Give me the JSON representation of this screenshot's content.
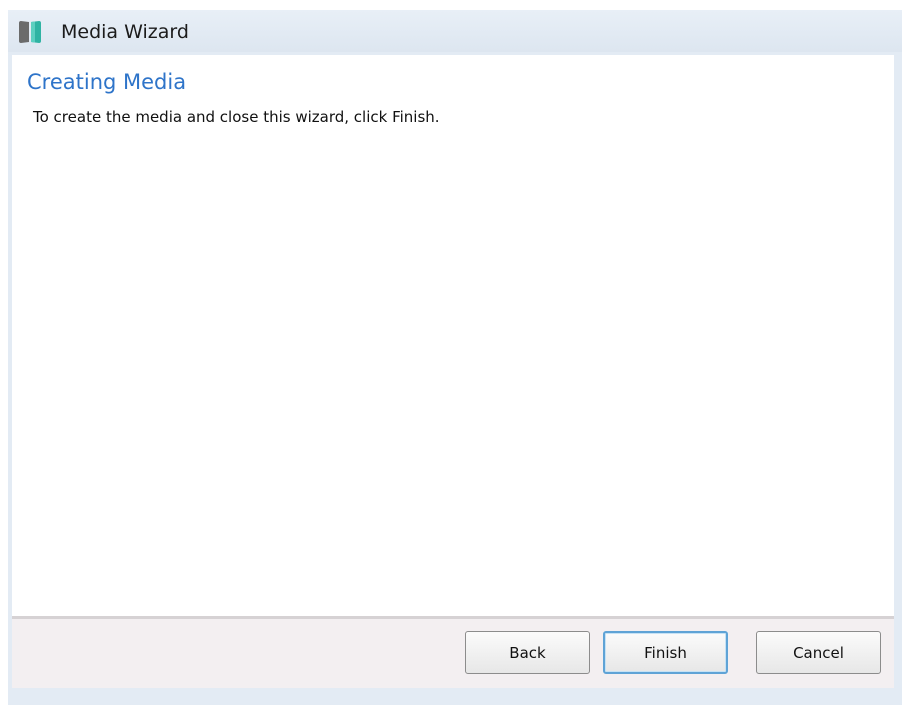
{
  "window": {
    "title": "Media Wizard",
    "icon": "media-wizard-app-icon"
  },
  "page": {
    "heading": "Creating Media",
    "instructions": "To create the media and close this wizard, click Finish."
  },
  "buttons": {
    "back": "Back",
    "finish": "Finish",
    "cancel": "Cancel"
  },
  "colors": {
    "heading": "#2e74c9",
    "titlebar": "#e3ebf4",
    "footer": "#f3eff1",
    "default_button_border": "#5fa3d6"
  }
}
